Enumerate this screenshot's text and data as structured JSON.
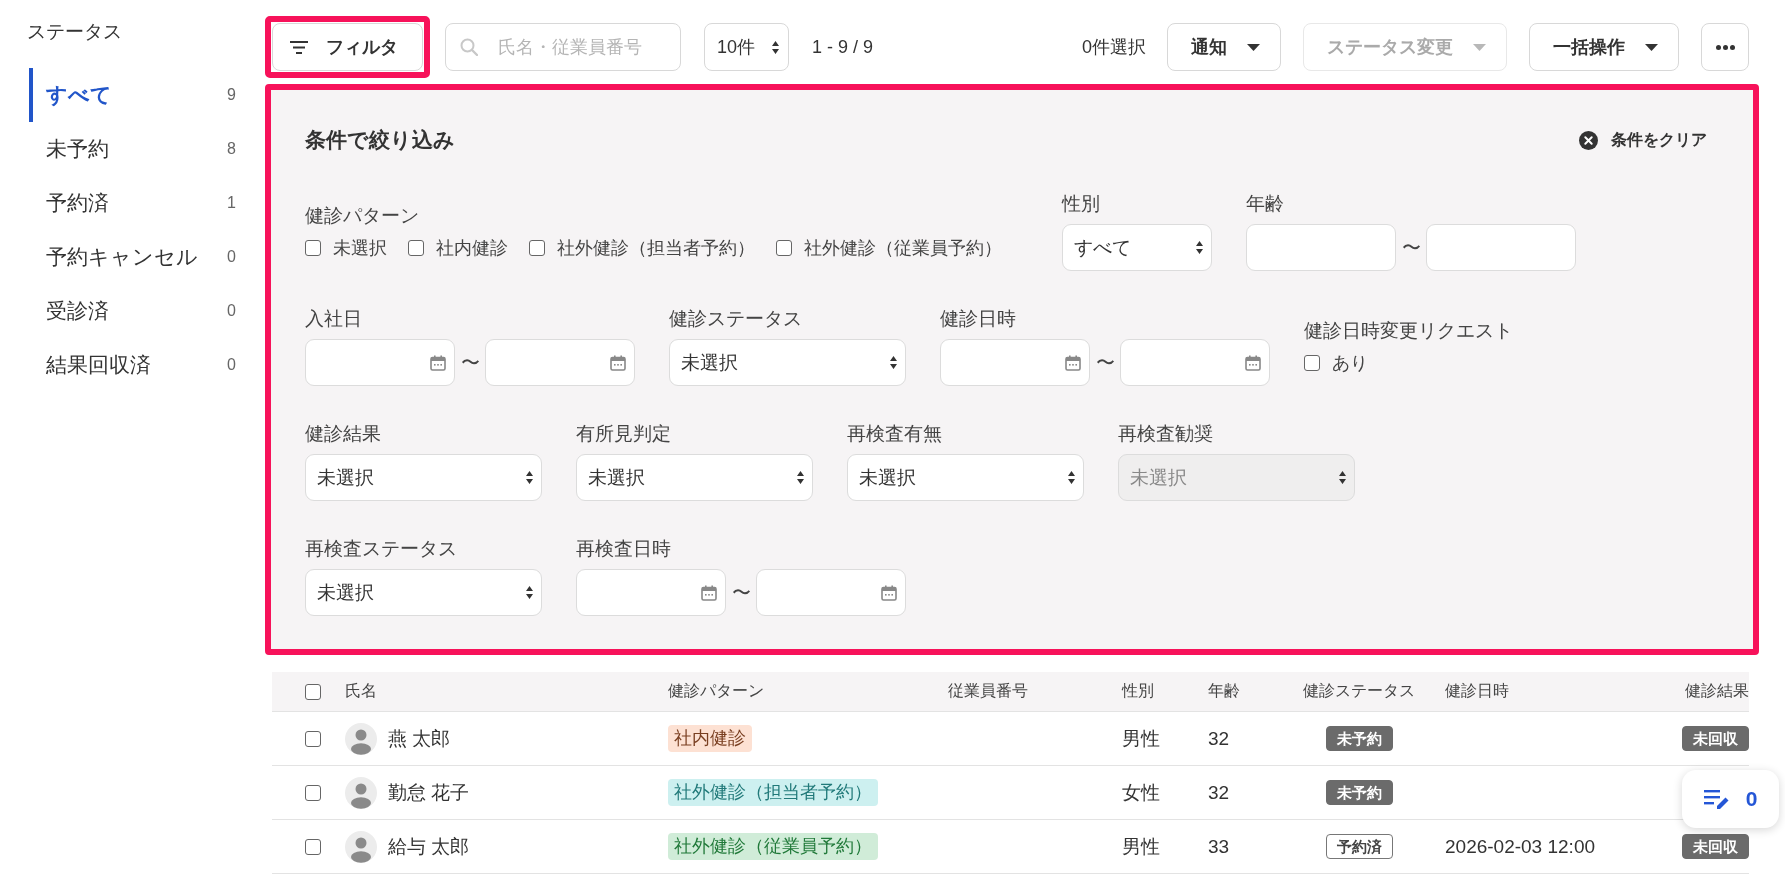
{
  "sidebar": {
    "title": "ステータス",
    "items": [
      {
        "label": "すべて",
        "count": "9",
        "selected": true
      },
      {
        "label": "未予約",
        "count": "8",
        "selected": false
      },
      {
        "label": "予約済",
        "count": "1",
        "selected": false
      },
      {
        "label": "予約キャンセル",
        "count": "0",
        "selected": false
      },
      {
        "label": "受診済",
        "count": "0",
        "selected": false
      },
      {
        "label": "結果回収済",
        "count": "0",
        "selected": false
      }
    ]
  },
  "toolbar": {
    "filter_button": {
      "label": "フィルタ",
      "highlighted": true
    },
    "search": {
      "placeholder": "氏名・従業員番号"
    },
    "per_page": {
      "value": "10件"
    },
    "range": "1 - 9 / 9",
    "selection_count": "0件選択",
    "buttons": [
      {
        "label": "通知",
        "disabled": false
      },
      {
        "label": "ステータス変更",
        "disabled": true
      },
      {
        "label": "一括操作",
        "disabled": false
      }
    ]
  },
  "filter_panel": {
    "highlighted": true,
    "title": "条件で絞り込み",
    "clear_label": "条件をクリア",
    "rows": [
      [
        {
          "kind": "checkboxes",
          "label": "健診パターン",
          "options": [
            {
              "label": "未選択",
              "checked": false
            },
            {
              "label": "社内健診",
              "checked": false
            },
            {
              "label": "社外健診（担当者予約）",
              "checked": false
            },
            {
              "label": "社外健診（従業員予約）",
              "checked": false
            }
          ]
        },
        {
          "kind": "select",
          "label": "性別",
          "value": "すべて",
          "disabled": false
        },
        {
          "kind": "number_range",
          "label": "年齢",
          "separator": "〜"
        }
      ],
      [
        {
          "kind": "date_range",
          "label": "入社日",
          "separator": "〜"
        },
        {
          "kind": "select",
          "label": "健診ステータス",
          "value": "未選択",
          "disabled": false
        },
        {
          "kind": "date_range",
          "label": "健診日時",
          "separator": "〜"
        },
        {
          "kind": "checkboxes",
          "label": "健診日時変更リクエスト",
          "options": [
            {
              "label": "あり",
              "checked": false
            }
          ]
        }
      ],
      [
        {
          "kind": "select",
          "label": "健診結果",
          "value": "未選択",
          "disabled": false
        },
        {
          "kind": "select",
          "label": "有所見判定",
          "value": "未選択",
          "disabled": false
        },
        {
          "kind": "select",
          "label": "再検査有無",
          "value": "未選択",
          "disabled": false
        },
        {
          "kind": "select",
          "label": "再検査勧奨",
          "value": "未選択",
          "disabled": true
        }
      ],
      [
        {
          "kind": "select",
          "label": "再検査ステータス",
          "value": "未選択",
          "disabled": false
        },
        {
          "kind": "date_range",
          "label": "再検査日時",
          "separator": "〜"
        }
      ]
    ]
  },
  "table": {
    "header_checkbox": {
      "checked": false
    },
    "columns": [
      "氏名",
      "健診パターン",
      "従業員番号",
      "性別",
      "年齢",
      "健診ステータス",
      "健診日時",
      "健診結果"
    ],
    "rows": [
      {
        "checked": false,
        "name": "燕 太郎",
        "pattern": {
          "label": "社内健診",
          "color": "#fde1d3"
        },
        "gender": "男性",
        "age": "32",
        "status": {
          "label": "未予約",
          "kind": "filled"
        },
        "result": {
          "label": "未回収",
          "kind": "filled"
        }
      },
      {
        "checked": false,
        "name": "勤怠 花子",
        "pattern": {
          "label": "社外健診（担当者予約）",
          "color": "#cdf0f0"
        },
        "gender": "女性",
        "age": "32",
        "status": {
          "label": "未予約",
          "kind": "filled"
        }
      },
      {
        "checked": false,
        "name": "給与 太郎",
        "pattern": {
          "label": "社外健診（従業員予約）",
          "color": "#d0ecd8"
        },
        "gender": "男性",
        "age": "33",
        "status": {
          "label": "予約済",
          "kind": "outline"
        },
        "datetime": "2026-02-03 12:00",
        "result": {
          "label": "未回収",
          "kind": "filled"
        }
      }
    ]
  },
  "floating_button": {
    "count": "0"
  }
}
